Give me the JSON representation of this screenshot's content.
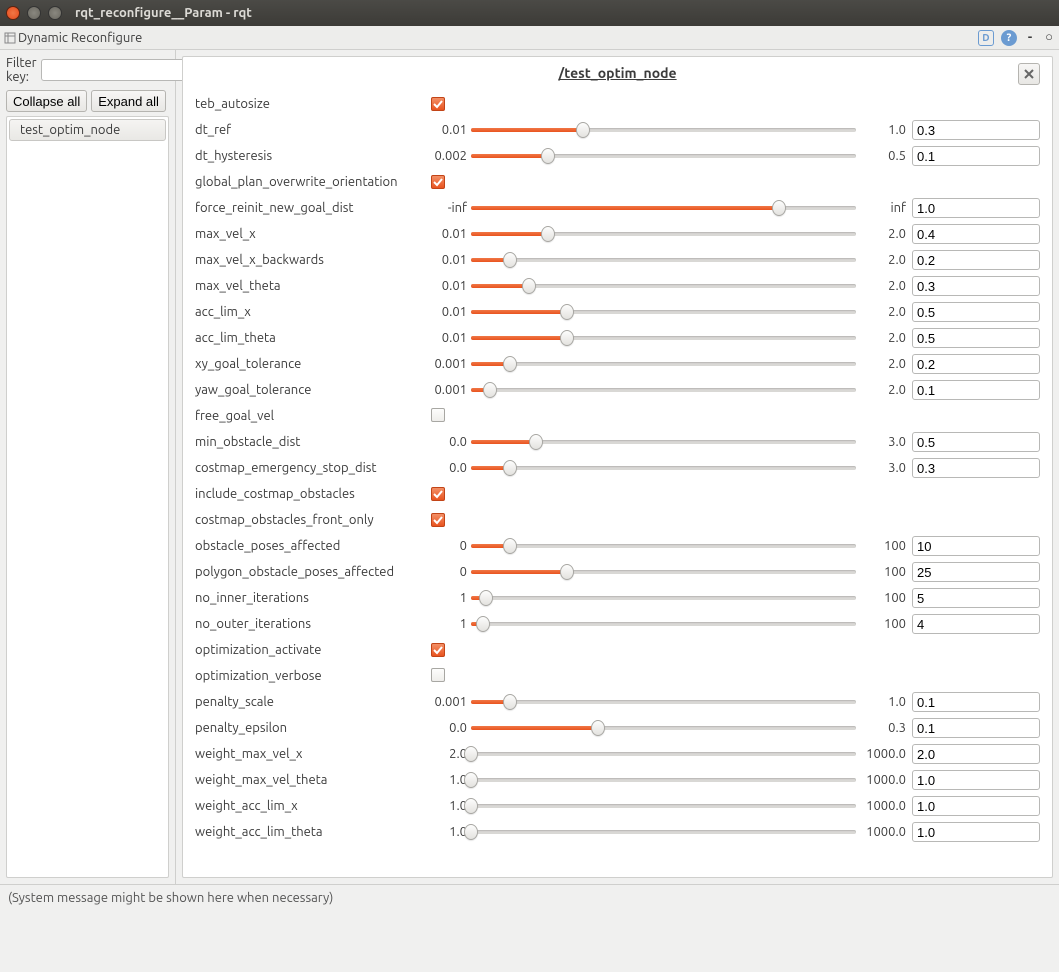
{
  "window": {
    "title": "rqt_reconfigure__Param - rqt"
  },
  "toolbar": {
    "title": "Dynamic Reconfigure"
  },
  "left": {
    "filter_label": "Filter key:",
    "filter_value": "",
    "collapse": "Collapse all",
    "expand": "Expand all",
    "nodes": [
      "test_optim_node"
    ]
  },
  "panel": {
    "title": "/test_optim_node",
    "close": "✕"
  },
  "status": "(System message might be shown here when necessary)",
  "params": [
    {
      "name": "teb_autosize",
      "type": "bool",
      "checked": true
    },
    {
      "name": "dt_ref",
      "type": "double",
      "min": "0.01",
      "max": "1.0",
      "frac": 0.29,
      "value": "0.3"
    },
    {
      "name": "dt_hysteresis",
      "type": "double",
      "min": "0.002",
      "max": "0.5",
      "frac": 0.2,
      "value": "0.1"
    },
    {
      "name": "global_plan_overwrite_orientation",
      "type": "bool",
      "checked": true
    },
    {
      "name": "force_reinit_new_goal_dist",
      "type": "double",
      "min": "-inf",
      "max": "inf",
      "frac": 0.8,
      "value": "1.0"
    },
    {
      "name": "max_vel_x",
      "type": "double",
      "min": "0.01",
      "max": "2.0",
      "frac": 0.2,
      "value": "0.4"
    },
    {
      "name": "max_vel_x_backwards",
      "type": "double",
      "min": "0.01",
      "max": "2.0",
      "frac": 0.1,
      "value": "0.2"
    },
    {
      "name": "max_vel_theta",
      "type": "double",
      "min": "0.01",
      "max": "2.0",
      "frac": 0.15,
      "value": "0.3"
    },
    {
      "name": "acc_lim_x",
      "type": "double",
      "min": "0.01",
      "max": "2.0",
      "frac": 0.25,
      "value": "0.5"
    },
    {
      "name": "acc_lim_theta",
      "type": "double",
      "min": "0.01",
      "max": "2.0",
      "frac": 0.25,
      "value": "0.5"
    },
    {
      "name": "xy_goal_tolerance",
      "type": "double",
      "min": "0.001",
      "max": "2.0",
      "frac": 0.1,
      "value": "0.2"
    },
    {
      "name": "yaw_goal_tolerance",
      "type": "double",
      "min": "0.001",
      "max": "2.0",
      "frac": 0.05,
      "value": "0.1"
    },
    {
      "name": "free_goal_vel",
      "type": "bool",
      "checked": false
    },
    {
      "name": "min_obstacle_dist",
      "type": "double",
      "min": "0.0",
      "max": "3.0",
      "frac": 0.17,
      "value": "0.5"
    },
    {
      "name": "costmap_emergency_stop_dist",
      "type": "double",
      "min": "0.0",
      "max": "3.0",
      "frac": 0.1,
      "value": "0.3"
    },
    {
      "name": "include_costmap_obstacles",
      "type": "bool",
      "checked": true
    },
    {
      "name": "costmap_obstacles_front_only",
      "type": "bool",
      "checked": true
    },
    {
      "name": "obstacle_poses_affected",
      "type": "int",
      "min": "0",
      "max": "100",
      "frac": 0.1,
      "value": "10"
    },
    {
      "name": "polygon_obstacle_poses_affected",
      "type": "int",
      "min": "0",
      "max": "100",
      "frac": 0.25,
      "value": "25"
    },
    {
      "name": "no_inner_iterations",
      "type": "int",
      "min": "1",
      "max": "100",
      "frac": 0.04,
      "value": "5"
    },
    {
      "name": "no_outer_iterations",
      "type": "int",
      "min": "1",
      "max": "100",
      "frac": 0.03,
      "value": "4"
    },
    {
      "name": "optimization_activate",
      "type": "bool",
      "checked": true
    },
    {
      "name": "optimization_verbose",
      "type": "bool",
      "checked": false
    },
    {
      "name": "penalty_scale",
      "type": "double",
      "min": "0.001",
      "max": "1.0",
      "frac": 0.1,
      "value": "0.1"
    },
    {
      "name": "penalty_epsilon",
      "type": "double",
      "min": "0.0",
      "max": "0.3",
      "frac": 0.33,
      "value": "0.1"
    },
    {
      "name": "weight_max_vel_x",
      "type": "double",
      "min": "2.0",
      "max": "1000.0",
      "frac": 0.0,
      "value": "2.0"
    },
    {
      "name": "weight_max_vel_theta",
      "type": "double",
      "min": "1.0",
      "max": "1000.0",
      "frac": 0.0,
      "value": "1.0"
    },
    {
      "name": "weight_acc_lim_x",
      "type": "double",
      "min": "1.0",
      "max": "1000.0",
      "frac": 0.0,
      "value": "1.0"
    },
    {
      "name": "weight_acc_lim_theta",
      "type": "double",
      "min": "1.0",
      "max": "1000.0",
      "frac": 0.0,
      "value": "1.0"
    }
  ]
}
